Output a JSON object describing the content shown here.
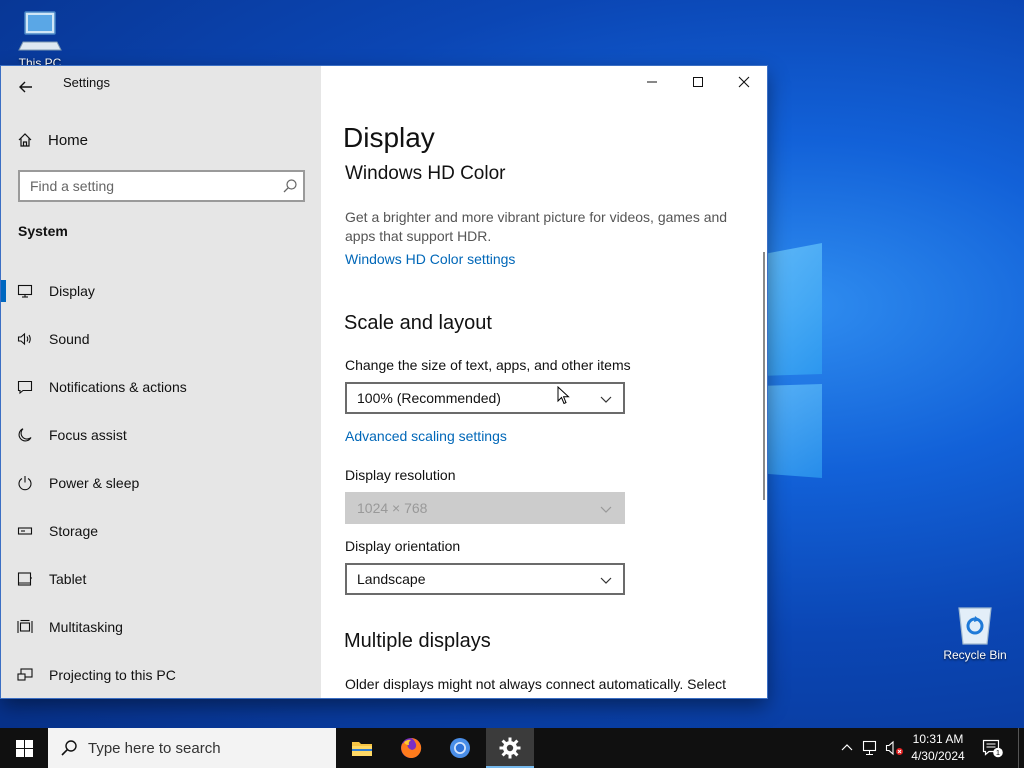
{
  "desktop": {
    "icons": [
      {
        "label": "This PC",
        "icon": "computer-icon"
      },
      {
        "label": "Recycle Bin",
        "icon": "recycle-bin-icon"
      }
    ]
  },
  "window": {
    "title": "Settings",
    "controls": {
      "minimize": "minimize-icon",
      "maximize": "maximize-icon",
      "close": "close-icon"
    }
  },
  "nav": {
    "home_label": "Home",
    "search_placeholder": "Find a setting",
    "section_label": "System",
    "items": [
      {
        "label": "Display",
        "icon": "monitor-icon",
        "selected": true
      },
      {
        "label": "Sound",
        "icon": "speaker-icon"
      },
      {
        "label": "Notifications & actions",
        "icon": "notification-icon"
      },
      {
        "label": "Focus assist",
        "icon": "moon-icon"
      },
      {
        "label": "Power & sleep",
        "icon": "power-icon"
      },
      {
        "label": "Storage",
        "icon": "storage-icon"
      },
      {
        "label": "Tablet",
        "icon": "tablet-icon"
      },
      {
        "label": "Multitasking",
        "icon": "multitasking-icon"
      },
      {
        "label": "Projecting to this PC",
        "icon": "projecting-icon"
      }
    ]
  },
  "content": {
    "page_title": "Display",
    "hd_color": {
      "heading": "Windows HD Color",
      "description": "Get a brighter and more vibrant picture for videos, games and apps that support HDR.",
      "link": "Windows HD Color settings"
    },
    "scale_layout": {
      "heading": "Scale and layout",
      "scale_label": "Change the size of text, apps, and other items",
      "scale_value": "100% (Recommended)",
      "advanced_link": "Advanced scaling settings",
      "resolution_label": "Display resolution",
      "resolution_value": "1024 × 768",
      "orientation_label": "Display orientation",
      "orientation_value": "Landscape"
    },
    "multiple_displays": {
      "heading": "Multiple displays",
      "description": "Older displays might not always connect automatically. Select"
    }
  },
  "taskbar": {
    "search_placeholder": "Type here to search",
    "apps": [
      {
        "name": "File Explorer",
        "icon": "folder-icon"
      },
      {
        "name": "Firefox",
        "icon": "firefox-icon"
      },
      {
        "name": "Chrome",
        "icon": "chrome-icon"
      },
      {
        "name": "Settings",
        "icon": "gear-icon",
        "active": true
      }
    ],
    "time": "10:31 AM",
    "date": "4/30/2024",
    "notification_count": "1"
  },
  "colors": {
    "accent": "#0067c0",
    "link": "#0067b8",
    "nav_background": "#e6e6e6",
    "taskbar": "#101010"
  }
}
